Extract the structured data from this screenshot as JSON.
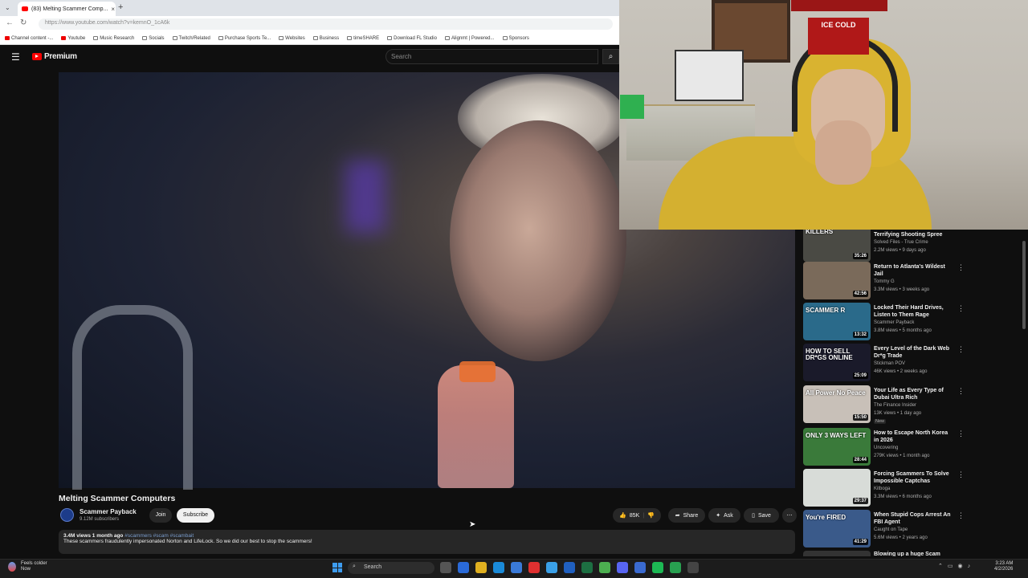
{
  "browser": {
    "tab_title": "(83) Melting Scammer Comp...",
    "new_tab": "+",
    "url": "https://www.youtube.com/watch?v=kemnO_1cA6k",
    "bookmarks": [
      "Channel content -...",
      "Youtube",
      "Music Research",
      "Socials",
      "Twitch/Related",
      "Purchase Sports Te...",
      "Websites",
      "Business",
      "timeSHARE",
      "Download FL Studio",
      "Alignmt | Powered...",
      "Sponsors"
    ]
  },
  "youtube": {
    "logo_text": "Premium",
    "search_placeholder": "Search"
  },
  "video": {
    "title": "Melting Scammer Computers",
    "channel": "Scammer Payback",
    "subscribers": "9.12M subscribers",
    "join": "Join",
    "subscribe": "Subscribe",
    "likes": "85K",
    "share": "Share",
    "ask": "Ask",
    "save": "Save",
    "stats": "3.4M views  1 month ago",
    "tags": "#scammers #scam #scambait",
    "description": "These scammers fraudulently impersonated Norton and LifeLock. So we did our best to stop the scammers!"
  },
  "webcam": {
    "sign_text": "ICE COLD"
  },
  "sidebar": [
    {
      "title": "Terrifying Shooting Spree",
      "channel": "Solved Files - True Crime",
      "views": "2.2M views • 9 days ago",
      "duration": "35:26",
      "thumb_text": "KILLERS",
      "thumb_color": "#4a4a44"
    },
    {
      "title": "Return to Atlanta's Wildest Jail",
      "channel": "Tommy G",
      "views": "3.3M views • 3 weeks ago",
      "duration": "42:56",
      "thumb_text": "",
      "thumb_color": "#7a6a5a"
    },
    {
      "title": "Locked Their Hard Drives, Listen to Them Rage",
      "channel": "Scammer Payback",
      "views": "3.8M views • 5 months ago",
      "duration": "13:32",
      "thumb_text": "SCAMMER R",
      "thumb_color": "#2a6a8a"
    },
    {
      "title": "Every Level of the Dark Web Dr*g Trade",
      "channel": "Stickman POV",
      "views": "46K views • 2 weeks ago",
      "duration": "25:09",
      "thumb_text": "HOW TO SELL DR*GS ONLINE",
      "thumb_color": "#1a1a2a"
    },
    {
      "title": "Your Life as Every Type of Dubai Ultra Rich",
      "channel": "The Finance Insider",
      "views": "13K views • 1 day ago",
      "duration": "15:50",
      "thumb_text": "All Power No Peace",
      "thumb_color": "#c8c0b8",
      "badge": "New"
    },
    {
      "title": "How to Escape North Korea in 2026",
      "channel": "Uncovering",
      "views": "279K views • 1 month ago",
      "duration": "28:44",
      "thumb_text": "ONLY 3 WAYS LEFT",
      "thumb_color": "#3a7a3a"
    },
    {
      "title": "Forcing Scammers To Solve Impossible Captchas",
      "channel": "Kitboga",
      "views": "3.3M views • 6 months ago",
      "duration": "29:37",
      "thumb_text": "",
      "thumb_color": "#d8dcd8"
    },
    {
      "title": "When Stupid Cops Arrest An FBI Agent",
      "channel": "Caught on Tape",
      "views": "5.6M views • 2 years ago",
      "duration": "41:29",
      "thumb_text": "You're FIRED",
      "thumb_color": "#3a5a8a"
    },
    {
      "title": "Blowing up a huge Scam Call...",
      "channel": "",
      "views": "",
      "duration": "",
      "thumb_text": "",
      "thumb_color": "#333"
    }
  ],
  "taskbar": {
    "weather_line1": "Feels colder",
    "weather_line2": "Now",
    "search": "Search",
    "time": "3:23 AM",
    "date": "4/2/2026"
  }
}
